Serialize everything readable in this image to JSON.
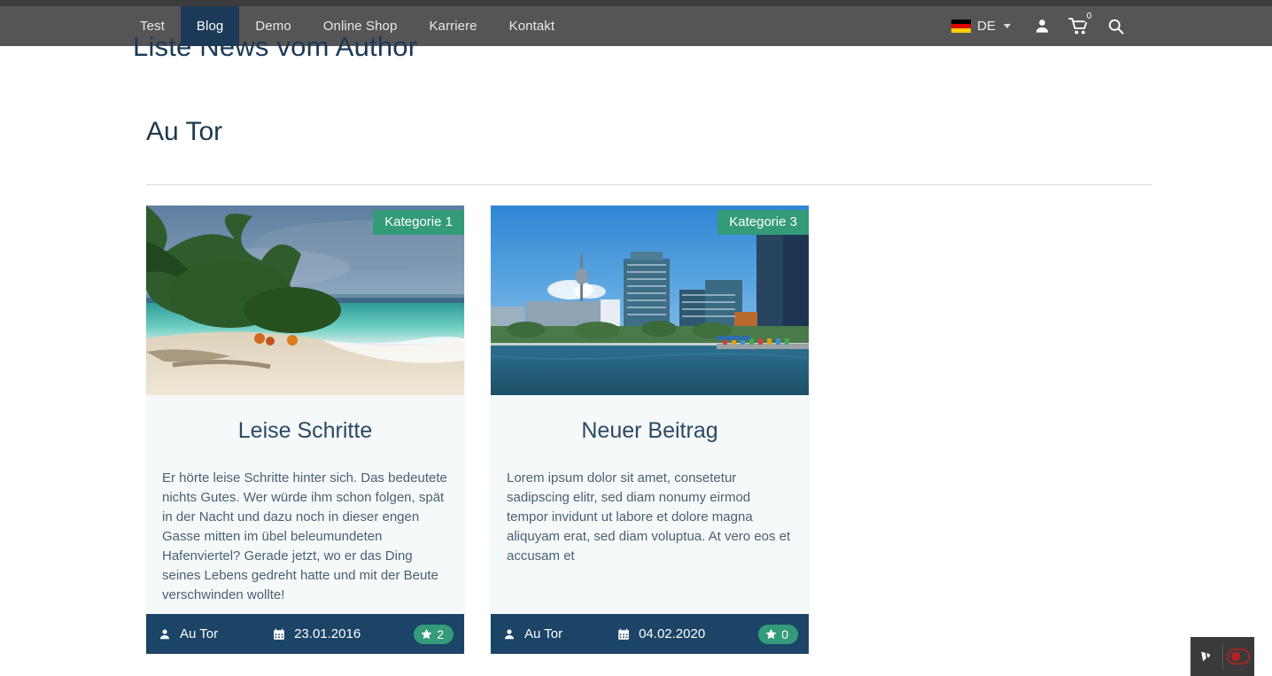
{
  "nav": {
    "items": [
      {
        "label": "Test",
        "active": false
      },
      {
        "label": "Blog",
        "active": true
      },
      {
        "label": "Demo",
        "active": false
      },
      {
        "label": "Online Shop",
        "active": false
      },
      {
        "label": "Karriere",
        "active": false
      },
      {
        "label": "Kontakt",
        "active": false
      }
    ],
    "language": {
      "label": "DE",
      "flag": "german-flag-icon"
    },
    "account_icon": "user-icon",
    "cart_icon": "shopping-cart-icon",
    "cart_count": "0",
    "search_icon": "search-icon",
    "active_color": "#1b3a57",
    "bar_color": "#555555"
  },
  "header": {
    "page_title": "Liste News vom Author"
  },
  "author": {
    "heading": "Au Tor"
  },
  "cards": [
    {
      "category": "Kategorie 1",
      "title": "Leise Schritte",
      "teaser": "Er hörte leise Schritte hinter sich. Das bedeutete nichts Gutes. Wer würde ihm schon folgen, spät in der Nacht und dazu noch in dieser engen Gasse mitten im übel beleumundeten Hafenviertel? Gerade jetzt, wo er das Ding seines Lebens gedreht hatte und mit der Beute verschwinden wollte!",
      "author": "Au Tor",
      "date": "23.01.2016",
      "rating": "2",
      "image_alt": "tropical-beach-photo"
    },
    {
      "category": "Kategorie 3",
      "title": "Neuer Beitrag",
      "teaser": "Lorem ipsum dolor sit amet, consetetur sadipscing elitr, sed diam nonumy eirmod tempor invidunt ut labore et dolore magna aliquyam erat, sed diam voluptua. At vero eos et accusam et",
      "author": "Au Tor",
      "date": "04.02.2020",
      "rating": "0",
      "image_alt": "city-skyline-waterfront-photo"
    }
  ],
  "badge_color": "#339b79",
  "footer_color": "#1b4466",
  "backend_bar": {
    "logo_icon": "contao-logo-icon",
    "toggle_icon": "red-toggle-icon"
  }
}
